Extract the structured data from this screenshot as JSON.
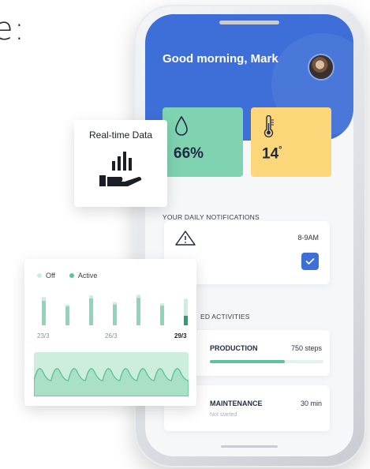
{
  "heading_fragment": "e:",
  "app": {
    "greeting": "Good morning, Mark",
    "tiles": {
      "humidity": {
        "value": "66%",
        "icon": "water-drop-icon"
      },
      "temperature": {
        "value": "14",
        "unit": "°",
        "icon": "thermometer-icon"
      }
    },
    "notifications": {
      "title": "YOUR DAILY NOTIFICATIONS",
      "time": "8-9AM",
      "icon": "warning-icon"
    },
    "activities": {
      "title_fragment": "ED ACTIVITIES",
      "items": [
        {
          "name": "PRODUCTION",
          "meta": "750 steps",
          "progress": 0.66
        },
        {
          "name": "MAINTENANCE",
          "meta": "30 min",
          "status": "Not started"
        }
      ]
    }
  },
  "realtime_card": {
    "label": "Real-time Data",
    "icon": "hand-bar-chart-icon"
  },
  "chart": {
    "legend": {
      "off": "Off",
      "active": "Active"
    },
    "colors": {
      "off": "#cdeedd",
      "active": "#5cc39a",
      "active_dark": "#2f9e6e"
    }
  },
  "chart_data": {
    "type": "bar",
    "x": [
      "23/3",
      "26/3",
      "29/3"
    ],
    "series": [
      {
        "name": "Off",
        "values": [
          0.85,
          0.62,
          0.9,
          0.7,
          0.92,
          0.66,
          0.8
        ]
      },
      {
        "name": "Active",
        "values": [
          0.8,
          0.62,
          0.88,
          0.68,
          0.9,
          0.64,
          0.48
        ]
      }
    ],
    "tick_labels": [
      "23/3",
      "26/3",
      "29/3"
    ],
    "grid": false,
    "legend_position": "top-left"
  },
  "colors": {
    "header_blue": "#3e6fd8",
    "humidity_tile": "#7fd3b1",
    "temperature_tile": "#fcd77a",
    "accent_green": "#5cc39a"
  }
}
